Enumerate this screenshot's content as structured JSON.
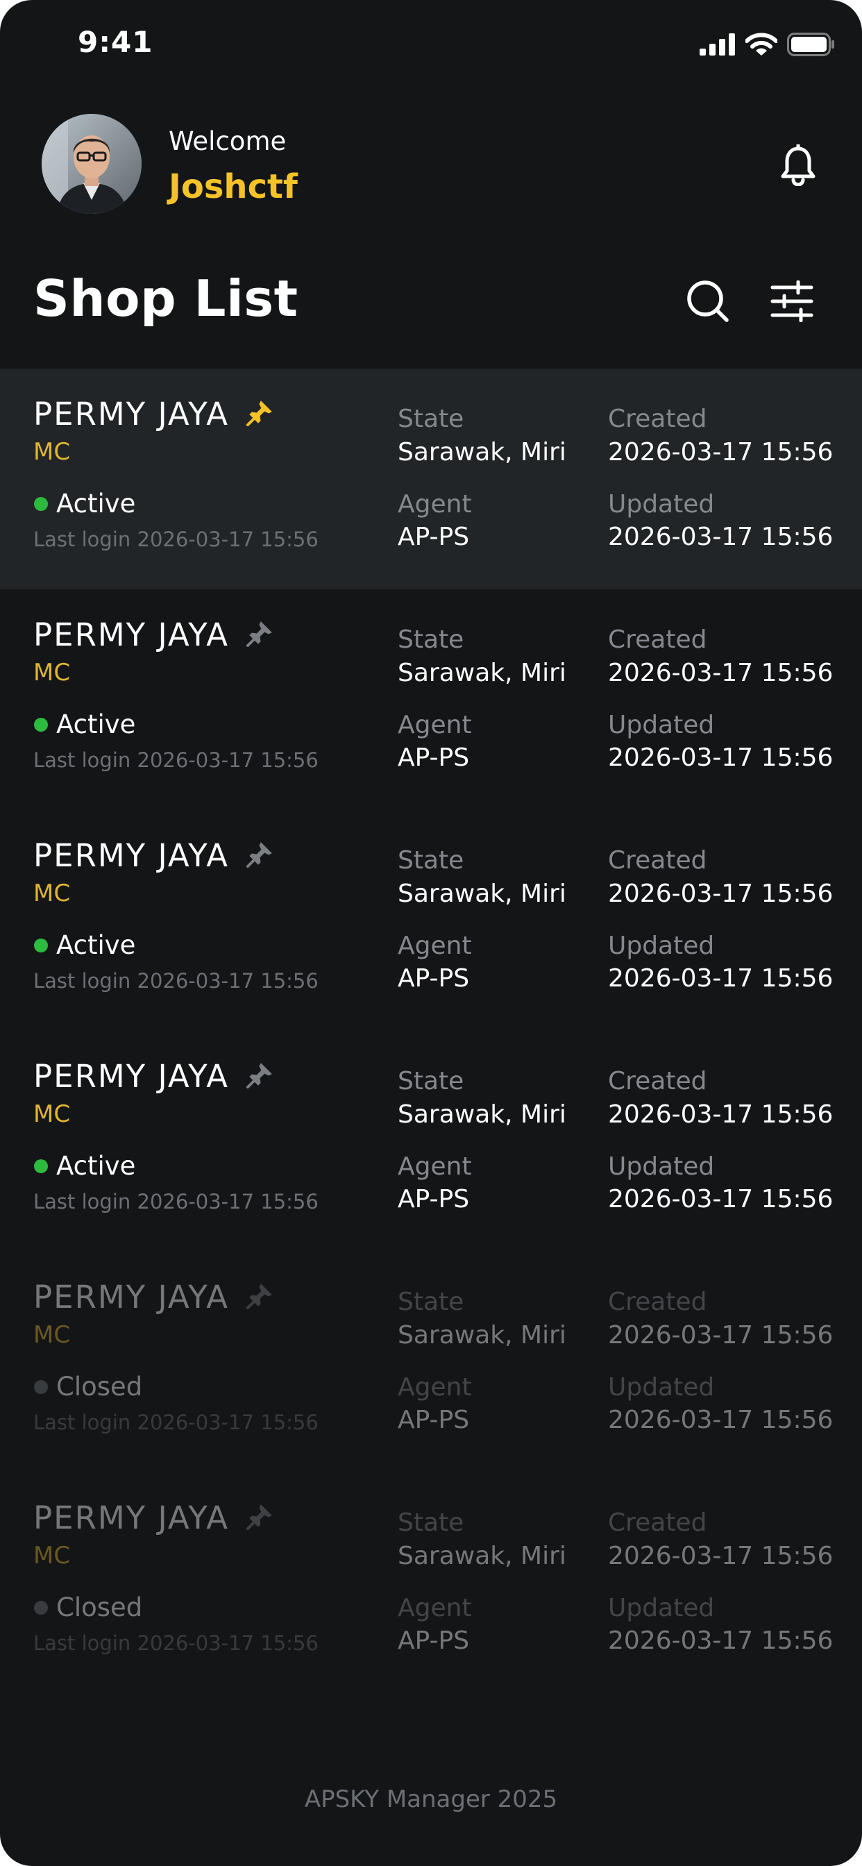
{
  "status_bar": {
    "time": "9:41"
  },
  "header": {
    "welcome_text": "Welcome",
    "username": "Joshctf",
    "title": "Shop List"
  },
  "colors": {
    "background": "#131517",
    "highlight_row": "#222527",
    "accent_yellow": "#f5c228",
    "active_green": "#2dbb3f",
    "closed_gray": "#6f7378"
  },
  "icons": {
    "notification": "bell-icon",
    "search": "search-icon",
    "filter": "sliders-icon",
    "pin": "pin-icon"
  },
  "labels": {
    "state": "State",
    "agent": "Agent",
    "created": "Created",
    "updated": "Updated"
  },
  "shops": [
    {
      "name": "PERMY JAYA",
      "type": "MC",
      "pinned": true,
      "selected": true,
      "status": "Active",
      "last_login": "Last login 2026-03-17  15:56",
      "state": "Sarawak, Miri",
      "agent": "AP-PS",
      "created": "2026-03-17  15:56",
      "updated": "2026-03-17  15:56"
    },
    {
      "name": "PERMY JAYA",
      "type": "MC",
      "pinned": false,
      "selected": false,
      "status": "Active",
      "last_login": "Last login 2026-03-17  15:56",
      "state": "Sarawak, Miri",
      "agent": "AP-PS",
      "created": "2026-03-17  15:56",
      "updated": "2026-03-17  15:56"
    },
    {
      "name": "PERMY JAYA",
      "type": "MC",
      "pinned": false,
      "selected": false,
      "status": "Active",
      "last_login": "Last login 2026-03-17  15:56",
      "state": "Sarawak, Miri",
      "agent": "AP-PS",
      "created": "2026-03-17  15:56",
      "updated": "2026-03-17  15:56"
    },
    {
      "name": "PERMY JAYA",
      "type": "MC",
      "pinned": false,
      "selected": false,
      "status": "Active",
      "last_login": "Last login 2026-03-17  15:56",
      "state": "Sarawak, Miri",
      "agent": "AP-PS",
      "created": "2026-03-17  15:56",
      "updated": "2026-03-17  15:56"
    },
    {
      "name": "PERMY JAYA",
      "type": "MC",
      "pinned": false,
      "selected": false,
      "status": "Closed",
      "last_login": "Last login 2026-03-17  15:56",
      "state": "Sarawak, Miri",
      "agent": "AP-PS",
      "created": "2026-03-17  15:56",
      "updated": "2026-03-17  15:56"
    },
    {
      "name": "PERMY JAYA",
      "type": "MC",
      "pinned": false,
      "selected": false,
      "status": "Closed",
      "last_login": "Last login 2026-03-17  15:56",
      "state": "Sarawak, Miri",
      "agent": "AP-PS",
      "created": "2026-03-17  15:56",
      "updated": "2026-03-17  15:56"
    }
  ],
  "footer": {
    "text": "APSKY Manager 2025"
  }
}
